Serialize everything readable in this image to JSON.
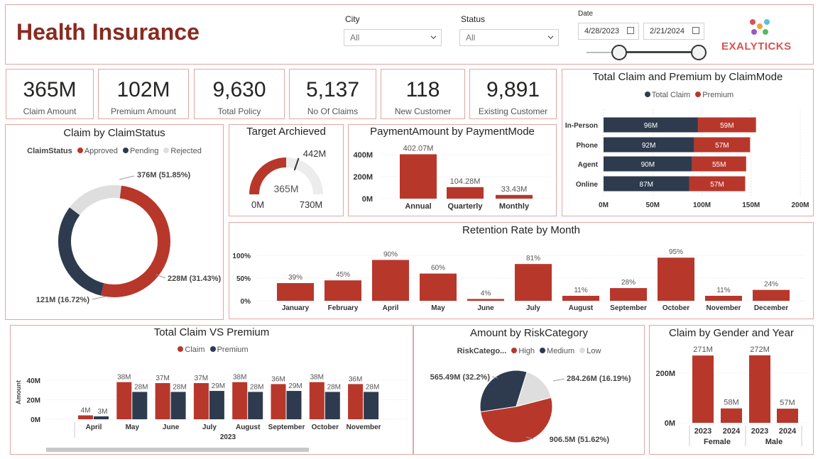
{
  "header": {
    "title": "Health Insurance",
    "brand": "EXALYTICKS",
    "filters": {
      "city_label": "City",
      "city_value": "All",
      "status_label": "Status",
      "status_value": "All",
      "date_label": "Date",
      "date_start": "4/28/2023",
      "date_end": "2/21/2024"
    }
  },
  "kpis": [
    {
      "value": "365M",
      "label": "Claim Amount"
    },
    {
      "value": "102M",
      "label": "Premium Amount"
    },
    {
      "value": "9,630",
      "label": "Total Policy"
    },
    {
      "value": "5,137",
      "label": "No Of Claims"
    },
    {
      "value": "118",
      "label": "New Customer"
    },
    {
      "value": "9,891",
      "label": "Existing Customer"
    }
  ],
  "colors": {
    "red": "#b8372b",
    "navy": "#2e3b4e",
    "gray": "#dedede",
    "border": "#e2a6a1"
  },
  "chart_data": [
    {
      "id": "claim_status",
      "type": "pie",
      "title": "Claim by ClaimStatus",
      "legend_title": "ClaimStatus",
      "categories": [
        "Approved",
        "Pending",
        "Rejected"
      ],
      "values": [
        376,
        228,
        121
      ],
      "labels": [
        "376M (51.85%)",
        "228M (31.43%)",
        "121M (16.72%)"
      ],
      "donut": true
    },
    {
      "id": "target",
      "type": "gauge",
      "title": "Target Archieved",
      "value": 365,
      "target": 442,
      "min": 0,
      "max": 730,
      "value_label": "365M",
      "target_label": "442M",
      "min_label": "0M",
      "max_label": "730M"
    },
    {
      "id": "payment_mode",
      "type": "bar",
      "title": "PaymentAmount by PaymentMode",
      "categories": [
        "Annual",
        "Quarterly",
        "Monthly"
      ],
      "values": [
        402.07,
        104.28,
        33.43
      ],
      "data_labels": [
        "402.07M",
        "104.28M",
        "33.43M"
      ],
      "yticks": [
        "0M",
        "200M",
        "400M"
      ],
      "ylim": [
        0,
        450
      ]
    },
    {
      "id": "claim_mode",
      "type": "bar",
      "orientation": "horizontal-stacked",
      "title": "Total Claim and Premium by ClaimMode",
      "categories": [
        "In-Person",
        "Phone",
        "Agent",
        "Online"
      ],
      "series": [
        {
          "name": "Total Claim",
          "values": [
            96,
            92,
            90,
            87
          ],
          "labels": [
            "96M",
            "92M",
            "90M",
            "87M"
          ]
        },
        {
          "name": "Premium",
          "values": [
            59,
            57,
            55,
            57
          ],
          "labels": [
            "59M",
            "57M",
            "55M",
            "57M"
          ]
        }
      ],
      "xticks": [
        "0M",
        "50M",
        "100M",
        "150M",
        "200M"
      ],
      "xlim": [
        0,
        200
      ]
    },
    {
      "id": "retention",
      "type": "bar",
      "title": "Retention Rate by Month",
      "categories": [
        "January",
        "February",
        "April",
        "May",
        "June",
        "July",
        "August",
        "September",
        "October",
        "November",
        "December"
      ],
      "values": [
        39,
        45,
        90,
        60,
        4,
        81,
        11,
        28,
        95,
        11,
        24
      ],
      "data_labels": [
        "39%",
        "45%",
        "90%",
        "60%",
        "4%",
        "81%",
        "11%",
        "28%",
        "95%",
        "11%",
        "24%"
      ],
      "yticks": [
        "0%",
        "50%",
        "100%"
      ],
      "ylim": [
        0,
        100
      ]
    },
    {
      "id": "claim_vs_premium",
      "type": "bar",
      "title": "Total Claim VS Premium",
      "categories": [
        "April",
        "May",
        "June",
        "July",
        "August",
        "September",
        "October",
        "November"
      ],
      "series": [
        {
          "name": "Claim",
          "values": [
            4,
            38,
            37,
            37,
            38,
            36,
            38,
            36
          ],
          "labels": [
            "4M",
            "38M",
            "37M",
            "37M",
            "38M",
            "36M",
            "38M",
            "36M"
          ]
        },
        {
          "name": "Premium",
          "values": [
            3,
            28,
            28,
            29,
            28,
            29,
            28,
            28
          ],
          "labels": [
            "3M",
            "28M",
            "28M",
            "29M",
            "28M",
            "29M",
            "28M",
            "28M"
          ]
        }
      ],
      "xlabel": "2023",
      "ylabel": "Amount",
      "yticks": [
        "0M",
        "20M",
        "40M"
      ],
      "ylim": [
        0,
        45
      ]
    },
    {
      "id": "risk",
      "type": "pie",
      "title": "Amount by RiskCategory",
      "legend_title": "RiskCatego...",
      "categories": [
        "High",
        "Medium",
        "Low"
      ],
      "values": [
        906.5,
        565.49,
        284.26
      ],
      "labels": [
        "906.5M (51.62%)",
        "565.49M (32.2%)",
        "284.26M (16.19%)"
      ]
    },
    {
      "id": "gender_year",
      "type": "bar",
      "title": "Claim by Gender and Year",
      "categories": [
        "2023",
        "2024",
        "2023",
        "2024"
      ],
      "groups": [
        "Female",
        "Male"
      ],
      "values": [
        271,
        58,
        272,
        57
      ],
      "data_labels": [
        "271M",
        "58M",
        "272M",
        "57M"
      ],
      "yticks": [
        "0M",
        "200M"
      ],
      "ylim": [
        0,
        300
      ]
    }
  ]
}
